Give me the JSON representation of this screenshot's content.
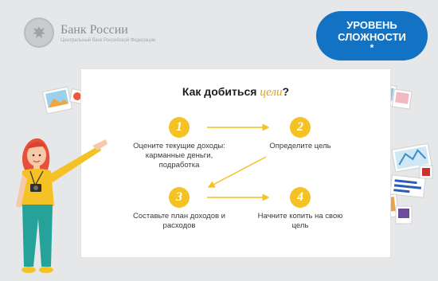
{
  "logo": {
    "name": "Банк России",
    "sub": "Центральный банк Российской Федерации"
  },
  "badge": {
    "line1": "УРОВЕНЬ",
    "line2": "СЛОЖНОСТИ",
    "star": "*"
  },
  "board": {
    "title_main": "Как добиться",
    "title_accent": "цели",
    "title_end": "?",
    "steps": [
      {
        "num": "1",
        "text": "Оцените текущие доходы: карманные деньги, подработка"
      },
      {
        "num": "2",
        "text": "Определите цель"
      },
      {
        "num": "3",
        "text": "Составьте план доходов и расходов"
      },
      {
        "num": "4",
        "text": "Начните копить на свою цель"
      }
    ]
  },
  "colors": {
    "background": "#e6e7e8",
    "badge": "#1272c4",
    "accent_yellow": "#f4c224",
    "title_accent": "#e0a21a"
  }
}
